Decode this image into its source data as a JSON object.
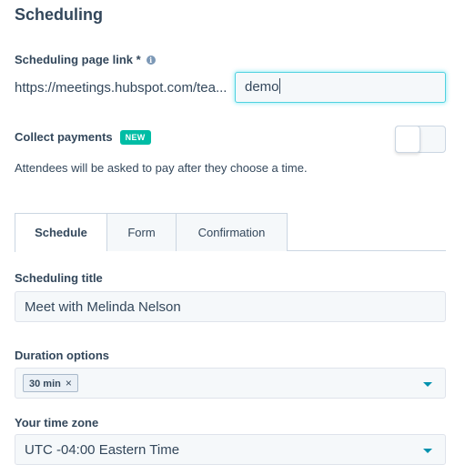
{
  "page": {
    "title": "Scheduling"
  },
  "link": {
    "label": "Scheduling page link *",
    "info_icon": "info-icon",
    "url_prefix": "https://meetings.hubspot.com/tea...",
    "slug_value": "demo"
  },
  "payments": {
    "label": "Collect payments",
    "badge": "NEW",
    "toggle_on": false,
    "help_text": "Attendees will be asked to pay after they choose a time."
  },
  "tabs": [
    {
      "label": "Schedule",
      "active": true
    },
    {
      "label": "Form",
      "active": false
    },
    {
      "label": "Confirmation",
      "active": false
    }
  ],
  "schedule": {
    "title_label": "Scheduling title",
    "title_value": "Meet with Melinda Nelson",
    "duration_label": "Duration options",
    "duration_chips": [
      {
        "label": "30 min",
        "remove_icon": "close-icon"
      }
    ],
    "timezone_label": "Your time zone",
    "timezone_value": "UTC -04:00 Eastern Time"
  },
  "colors": {
    "text": "#33475b",
    "badge": "#00bda5",
    "focus": "#4fd1e0",
    "caret": "#0091ae"
  }
}
